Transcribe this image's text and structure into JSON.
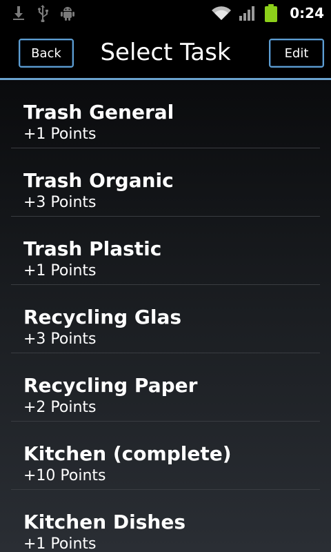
{
  "status_bar": {
    "icons_left": [
      "download-icon",
      "usb-icon",
      "android-debug-icon"
    ],
    "icons_right": [
      "wifi-icon",
      "signal-icon",
      "battery-icon"
    ],
    "time": "0:24",
    "battery_color": "#8cd01a"
  },
  "header": {
    "title": "Select Task",
    "back_label": "Back",
    "edit_label": "Edit",
    "accent_color": "#5e9fd3"
  },
  "tasks": [
    {
      "name": "Trash General",
      "points": "+1 Points"
    },
    {
      "name": "Trash Organic",
      "points": "+3 Points"
    },
    {
      "name": "Trash Plastic",
      "points": "+1 Points"
    },
    {
      "name": "Recycling Glas",
      "points": "+3 Points"
    },
    {
      "name": "Recycling Paper",
      "points": "+2 Points"
    },
    {
      "name": "Kitchen (complete)",
      "points": "+10 Points"
    },
    {
      "name": "Kitchen Dishes",
      "points": "+1 Points"
    }
  ]
}
